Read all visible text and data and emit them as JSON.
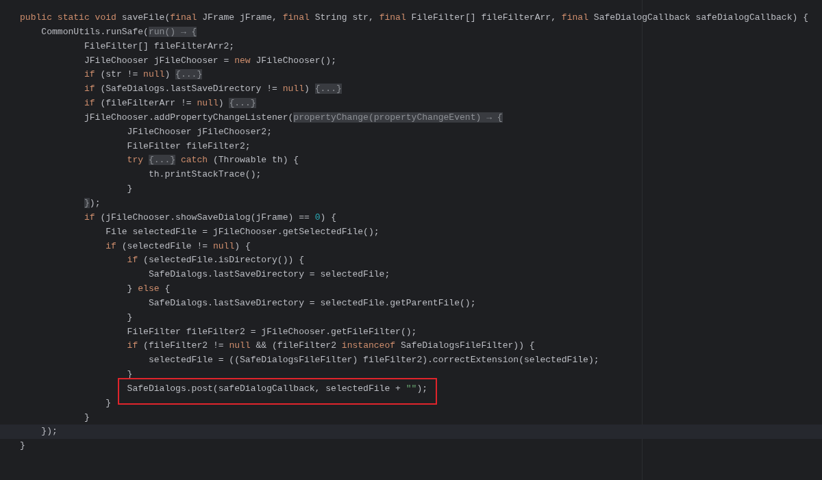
{
  "editor": {
    "lines": [
      {
        "tokens": [
          {
            "kind": "kw",
            "text": "public static void"
          },
          {
            "kind": "plain",
            "text": " saveFile("
          },
          {
            "kind": "kw",
            "text": "final"
          },
          {
            "kind": "plain",
            "text": " JFrame jFrame, "
          },
          {
            "kind": "kw",
            "text": "final"
          },
          {
            "kind": "plain",
            "text": " String str, "
          },
          {
            "kind": "kw",
            "text": "final"
          },
          {
            "kind": "plain",
            "text": " FileFilter[] fileFilterArr, "
          },
          {
            "kind": "kw",
            "text": "final"
          },
          {
            "kind": "plain",
            "text": " SafeDialogCallback safeDialogCallback) {"
          }
        ]
      },
      {
        "tokens": [
          {
            "kind": "plain",
            "text": "    CommonUtils.runSafe("
          },
          {
            "kind": "fold",
            "text": "run() → {"
          }
        ]
      },
      {
        "tokens": [
          {
            "kind": "plain",
            "text": "            FileFilter[] fileFilterArr2;"
          }
        ]
      },
      {
        "tokens": [
          {
            "kind": "plain",
            "text": "            JFileChooser jFileChooser = "
          },
          {
            "kind": "kw",
            "text": "new"
          },
          {
            "kind": "plain",
            "text": " JFileChooser();"
          }
        ]
      },
      {
        "tokens": [
          {
            "kind": "kw",
            "text": "            if"
          },
          {
            "kind": "plain",
            "text": " (str != "
          },
          {
            "kind": "kw",
            "text": "null"
          },
          {
            "kind": "plain",
            "text": ") "
          },
          {
            "kind": "fold",
            "text": "{...}"
          }
        ]
      },
      {
        "tokens": [
          {
            "kind": "kw",
            "text": "            if"
          },
          {
            "kind": "plain",
            "text": " (SafeDialogs.lastSaveDirectory != "
          },
          {
            "kind": "kw",
            "text": "null"
          },
          {
            "kind": "plain",
            "text": ") "
          },
          {
            "kind": "fold",
            "text": "{...}"
          }
        ]
      },
      {
        "tokens": [
          {
            "kind": "kw",
            "text": "            if"
          },
          {
            "kind": "plain",
            "text": " (fileFilterArr != "
          },
          {
            "kind": "kw",
            "text": "null"
          },
          {
            "kind": "plain",
            "text": ") "
          },
          {
            "kind": "fold",
            "text": "{...}"
          }
        ]
      },
      {
        "tokens": [
          {
            "kind": "plain",
            "text": "            jFileChooser.addPropertyChangeListener("
          },
          {
            "kind": "fold",
            "text": "propertyChange(propertyChangeEvent) → {"
          }
        ]
      },
      {
        "tokens": [
          {
            "kind": "plain",
            "text": "                    JFileChooser jFileChooser2;"
          }
        ]
      },
      {
        "tokens": [
          {
            "kind": "plain",
            "text": "                    FileFilter fileFilter2;"
          }
        ]
      },
      {
        "tokens": [
          {
            "kind": "kw",
            "text": "                    try "
          },
          {
            "kind": "fold",
            "text": "{...}"
          },
          {
            "kind": "kw",
            "text": " catch"
          },
          {
            "kind": "plain",
            "text": " (Throwable th) {"
          }
        ]
      },
      {
        "tokens": [
          {
            "kind": "plain",
            "text": "                        th.printStackTrace();"
          }
        ]
      },
      {
        "tokens": [
          {
            "kind": "plain",
            "text": "                    }"
          }
        ]
      },
      {
        "tokens": [
          {
            "kind": "fold",
            "text": "            }"
          },
          {
            "kind": "plain",
            "text": ");"
          }
        ]
      },
      {
        "tokens": [
          {
            "kind": "kw",
            "text": "            if"
          },
          {
            "kind": "plain",
            "text": " (jFileChooser.showSaveDialog(jFrame) == "
          },
          {
            "kind": "num",
            "text": "0"
          },
          {
            "kind": "plain",
            "text": ") {"
          }
        ]
      },
      {
        "tokens": [
          {
            "kind": "plain",
            "text": "                File selectedFile = jFileChooser.getSelectedFile();"
          }
        ]
      },
      {
        "tokens": [
          {
            "kind": "kw",
            "text": "                if"
          },
          {
            "kind": "plain",
            "text": " (selectedFile != "
          },
          {
            "kind": "kw",
            "text": "null"
          },
          {
            "kind": "plain",
            "text": ") {"
          }
        ]
      },
      {
        "tokens": [
          {
            "kind": "kw",
            "text": "                    if"
          },
          {
            "kind": "plain",
            "text": " (selectedFile.isDirectory()) {"
          }
        ]
      },
      {
        "tokens": [
          {
            "kind": "plain",
            "text": "                        SafeDialogs.lastSaveDirectory = selectedFile;"
          }
        ]
      },
      {
        "tokens": [
          {
            "kind": "plain",
            "text": "                    } "
          },
          {
            "kind": "kw",
            "text": "else"
          },
          {
            "kind": "plain",
            "text": " {"
          }
        ]
      },
      {
        "tokens": [
          {
            "kind": "plain",
            "text": "                        SafeDialogs.lastSaveDirectory = selectedFile.getParentFile();"
          }
        ]
      },
      {
        "tokens": [
          {
            "kind": "plain",
            "text": "                    }"
          }
        ]
      },
      {
        "tokens": [
          {
            "kind": "plain",
            "text": "                    FileFilter fileFilter2 = jFileChooser.getFileFilter();"
          }
        ]
      },
      {
        "tokens": [
          {
            "kind": "kw",
            "text": "                    if"
          },
          {
            "kind": "plain",
            "text": " (fileFilter2 != "
          },
          {
            "kind": "kw",
            "text": "null"
          },
          {
            "kind": "plain",
            "text": " && (fileFilter2 "
          },
          {
            "kind": "kw",
            "text": "instanceof"
          },
          {
            "kind": "plain",
            "text": " SafeDialogsFileFilter)) {"
          }
        ]
      },
      {
        "tokens": [
          {
            "kind": "plain",
            "text": "                        selectedFile = ((SafeDialogsFileFilter) fileFilter2).correctExtension(selectedFile);"
          }
        ]
      },
      {
        "tokens": [
          {
            "kind": "plain",
            "text": "                    }"
          }
        ]
      },
      {
        "marked": true,
        "tokens": [
          {
            "kind": "plain",
            "text": "                    SafeDialogs.post(safeDialogCallback, selectedFile + "
          },
          {
            "kind": "str",
            "text": "\"\""
          },
          {
            "kind": "plain",
            "text": ");"
          }
        ]
      },
      {
        "tokens": [
          {
            "kind": "plain",
            "text": "                }"
          }
        ]
      },
      {
        "tokens": [
          {
            "kind": "plain",
            "text": "            }"
          }
        ]
      },
      {
        "current": true,
        "tokens": [
          {
            "kind": "plain",
            "text": "    });"
          }
        ]
      },
      {
        "tokens": [
          {
            "kind": "plain",
            "text": "}"
          }
        ]
      }
    ]
  }
}
